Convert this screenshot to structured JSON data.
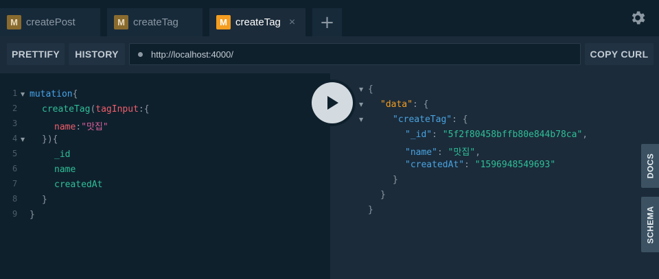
{
  "tabs": [
    {
      "badge": "M",
      "label": "createPost"
    },
    {
      "badge": "M",
      "label": "createTag"
    },
    {
      "badge": "M",
      "label": "createTag",
      "close": "×"
    }
  ],
  "tab_add": "+",
  "toolbar": {
    "prettify": "PRETTIFY",
    "history": "HISTORY",
    "url": "http://localhost:4000/",
    "copy_curl": "COPY CURL"
  },
  "editor": {
    "line_numbers": [
      "1",
      "2",
      "3",
      "4",
      "5",
      "6",
      "7",
      "8",
      "9"
    ],
    "lines": {
      "l1_kw": "mutation",
      "l1_brace": "{",
      "l2_fn": "createTag",
      "l2_paren": "(",
      "l2_arg": "tagInput",
      "l2_rest": ":{",
      "l3_key": "name",
      "l3_colon": ":",
      "l3_str": "\"맛집\"",
      "l4": "}){",
      "l5": "_id",
      "l6": "name",
      "l7": "createdAt",
      "l8": "}",
      "l9": "}"
    }
  },
  "result": {
    "open": "{",
    "data_key": "\"data\"",
    "data_open": ": {",
    "createTag_key": "\"createTag\"",
    "createTag_open": ": {",
    "id_key": "\"_id\"",
    "id_val": "\"5f2f80458bffb80e844b78ca\"",
    "name_key": "\"name\"",
    "name_val": "\"맛집\"",
    "createdAt_key": "\"createdAt\"",
    "createdAt_val": "\"1596948549693\"",
    "close3": "}",
    "close2": "}",
    "close1": "}"
  },
  "side_tabs": {
    "docs": "DOCS",
    "schema": "SCHEMA"
  },
  "colors": {
    "accent": "#f49d20",
    "background": "#0f202d",
    "panel": "#1b2b3a"
  }
}
